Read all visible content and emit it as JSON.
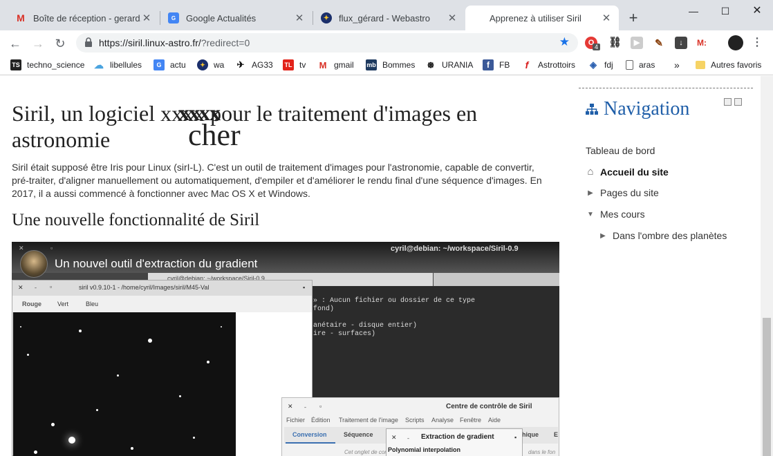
{
  "browser": {
    "tabs": [
      {
        "title": "Boîte de réception - gerard.ar",
        "favicon": "gmail-icon"
      },
      {
        "title": "Google Actualités",
        "favicon": "google-news-icon"
      },
      {
        "title": "flux_gérard - Webastro",
        "favicon": "webastro-icon"
      },
      {
        "title": "Apprenez à utiliser Siril",
        "favicon": "siril-icon",
        "active": true
      }
    ],
    "url_main": "https://siril.linux-astro.fr/",
    "url_query": "?redirect=0",
    "extension_badge": "4",
    "extension_m_label": "M:",
    "bookmarks": [
      {
        "label": "techno_science",
        "icon": "ts"
      },
      {
        "label": "libellules",
        "icon": "cloud"
      },
      {
        "label": "actu",
        "icon": "gn"
      },
      {
        "label": "wa",
        "icon": "wa"
      },
      {
        "label": "AG33",
        "icon": "ag"
      },
      {
        "label": "tv",
        "icon": "tl"
      },
      {
        "label": "gmail",
        "icon": "m"
      },
      {
        "label": "Bommes",
        "icon": "mb"
      },
      {
        "label": "URANIA",
        "icon": "u"
      },
      {
        "label": "FB",
        "icon": "f"
      },
      {
        "label": "Astrottoirs",
        "icon": "a"
      },
      {
        "label": "fdj",
        "icon": "fd"
      },
      {
        "label": "aras",
        "icon": "doc"
      }
    ],
    "bookmarks_more": "»",
    "other_bookmarks": "Autres favoris"
  },
  "page": {
    "title": "Siril, un logiciel xxxx pour le traitement d'images en astronomie",
    "overlay_top": "xxxx",
    "overlay_bottom": "cher",
    "intro": "Siril était supposé être Iris pour Linux (sirI-L). C'est un outil de traitement d'images pour l'astronomie, capable de convertir, pré-traiter, d'aligner manuellement ou automatiquement, d'empiler et d'améliorer le rendu final d'une séquence d'images. En 2017, il a aussi commencé à fonctionner avec Mac OS X et Windows.",
    "subtitle": "Une nouvelle fonctionnalité de Siril"
  },
  "video": {
    "title": "Un nouvel outil d'extraction du gradient",
    "terminal_title": "cyril@debian: ~/workspace/Siril-0.9",
    "terminal_tab": "cyril@debian: ~/workspace/Siril-0.9",
    "terminal_lines": [
      "» : Aucun fichier ou dossier de ce type",
      "fond)",
      "",
      "anétaire - disque entier)",
      "ire - surfaces)"
    ],
    "siril_title": "siril v0.9.10-1 - /home/cyril/Images/siril/M45-Val",
    "channels": [
      "Rouge",
      "Vert",
      "Bleu"
    ],
    "control_title": "Centre de contrôle de Siril",
    "control_menu": [
      "Fichier",
      "Édition",
      "Traitement de l'image",
      "Scripts",
      "Analyse",
      "Fenêtre",
      "Aide"
    ],
    "control_tabs": [
      "Conversion",
      "Séquence",
      "hique",
      "E"
    ],
    "control_note": "Cet onglet de con",
    "control_note2": "dans le fon",
    "gradient_title": "Extraction de gradient",
    "gradient_sub": "Polynomial interpolation"
  },
  "navigation": {
    "title": "Navigation",
    "items": [
      {
        "label": "Tableau de bord"
      },
      {
        "label": "Accueil du site"
      },
      {
        "label": "Pages du site"
      },
      {
        "label": "Mes cours"
      },
      {
        "label": "Dans l'ombre des planètes"
      }
    ]
  }
}
